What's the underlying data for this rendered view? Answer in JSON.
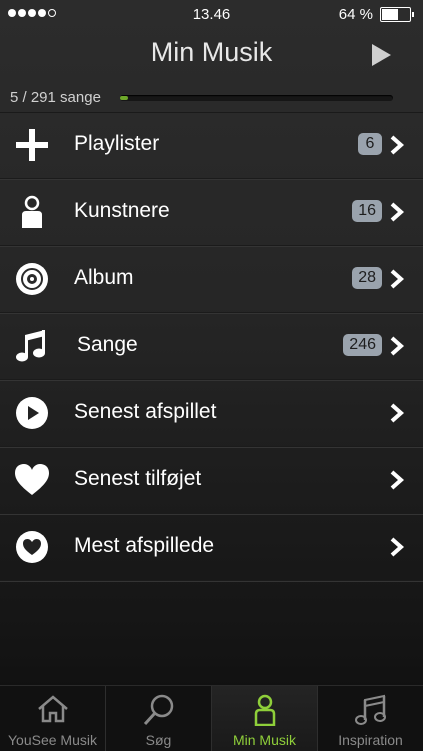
{
  "status_bar": {
    "time": "13.46",
    "battery": "64 %",
    "battery_level": 0.64
  },
  "header": {
    "title": "Min Musik"
  },
  "progress": {
    "text": "5 / 291 sange",
    "fraction": 0.017
  },
  "list": [
    {
      "label": "Playlister",
      "count": "6",
      "icon": "plus-icon"
    },
    {
      "label": "Kunstnere",
      "count": "16",
      "icon": "person-icon"
    },
    {
      "label": "Album",
      "count": "28",
      "icon": "cd-icon"
    },
    {
      "label": "Sange",
      "count": "246",
      "icon": "music-note-icon"
    },
    {
      "label": "Senest afspillet",
      "count": "",
      "icon": "play-circle-icon"
    },
    {
      "label": "Senest tilføjet",
      "count": "",
      "icon": "heart-icon"
    },
    {
      "label": "Mest afspillede",
      "count": "",
      "icon": "heart-circle-icon"
    }
  ],
  "tabs": [
    {
      "label": "YouSee Musik",
      "icon": "home-icon",
      "active": false
    },
    {
      "label": "Søg",
      "icon": "search-icon",
      "active": false
    },
    {
      "label": "Min Musik",
      "icon": "person-icon",
      "active": true
    },
    {
      "label": "Inspiration",
      "icon": "music-note-icon",
      "active": false
    }
  ],
  "colors": {
    "accent": "#8fcf3a",
    "badge": "#9aa3ad"
  }
}
